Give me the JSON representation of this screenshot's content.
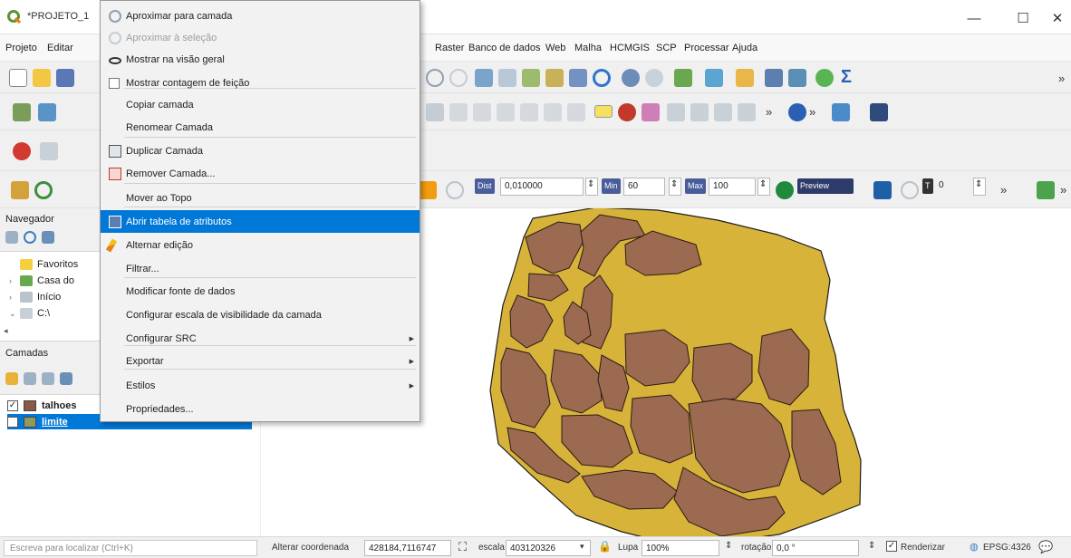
{
  "window": {
    "title": "*PROJETO_1",
    "minimize": "—",
    "maximize": "☐",
    "close": "✕"
  },
  "menubar": {
    "items": [
      "Projeto",
      "Editar",
      "Raster",
      "Banco de dados",
      "Web",
      "Malha",
      "HCMGIS",
      "SCP",
      "Processar",
      "Ajuda"
    ]
  },
  "toolbar": {
    "overflow": "»"
  },
  "snapping": {
    "dist_tag": "Dist",
    "dist_value": "0,010000",
    "min_tag": "Min",
    "min_value": "60",
    "max_tag": "Max",
    "max_value": "100",
    "preview_label": "Preview",
    "t_tag": "T",
    "t_value": "0"
  },
  "browser_panel": {
    "title": "Navegador",
    "items": [
      {
        "label": "Favoritos",
        "arrow": ""
      },
      {
        "label": "Casa do",
        "arrow": "›"
      },
      {
        "label": "Início",
        "arrow": "›"
      },
      {
        "label": "C:\\",
        "arrow": "⌄"
      }
    ],
    "scroll_left": "◂"
  },
  "layers_panel": {
    "title": "Camadas",
    "layers": [
      {
        "name": "talhoes",
        "checked": "✓",
        "color": "#8a5a44",
        "selected": false
      },
      {
        "name": "limite",
        "checked": "✓",
        "color": "#8f9a5e",
        "selected": true
      }
    ]
  },
  "context_menu": {
    "items": [
      {
        "label": "Aproximar para camada",
        "disabled": false,
        "selected": false,
        "submenu": false,
        "icon": "zoom-layer-icon"
      },
      {
        "label": "Aproximar à seleção",
        "disabled": true,
        "selected": false,
        "submenu": false,
        "icon": "zoom-selection-icon"
      },
      {
        "label": "Mostrar na visão geral",
        "disabled": false,
        "selected": false,
        "submenu": false,
        "icon": "overview-icon"
      },
      {
        "label": "Mostrar contagem de feição",
        "disabled": false,
        "selected": false,
        "submenu": false,
        "icon": "checkbox-icon"
      },
      {
        "label": "Copiar camada",
        "disabled": false,
        "selected": false,
        "submenu": false,
        "icon": ""
      },
      {
        "label": "Renomear Camada",
        "disabled": false,
        "selected": false,
        "submenu": false,
        "icon": ""
      },
      {
        "label": "Duplicar Camada",
        "disabled": false,
        "selected": false,
        "submenu": false,
        "icon": "duplicate-icon"
      },
      {
        "label": "Remover Camada...",
        "disabled": false,
        "selected": false,
        "submenu": false,
        "icon": "remove-icon"
      },
      {
        "label": "Mover ao Topo",
        "disabled": false,
        "selected": false,
        "submenu": false,
        "icon": ""
      },
      {
        "label": "Abrir tabela de atributos",
        "disabled": false,
        "selected": true,
        "submenu": false,
        "icon": "table-icon"
      },
      {
        "label": "Alternar edição",
        "disabled": false,
        "selected": false,
        "submenu": false,
        "icon": "pencil-icon"
      },
      {
        "label": "Filtrar...",
        "disabled": false,
        "selected": false,
        "submenu": false,
        "icon": ""
      },
      {
        "label": "Modificar fonte de dados",
        "disabled": false,
        "selected": false,
        "submenu": false,
        "icon": ""
      },
      {
        "label": "Configurar escala de visibilidade da camada",
        "disabled": false,
        "selected": false,
        "submenu": false,
        "icon": ""
      },
      {
        "label": "Configurar SRC",
        "disabled": false,
        "selected": false,
        "submenu": true,
        "icon": ""
      },
      {
        "label": "Exportar",
        "disabled": false,
        "selected": false,
        "submenu": true,
        "icon": ""
      },
      {
        "label": "Estilos",
        "disabled": false,
        "selected": false,
        "submenu": true,
        "icon": ""
      },
      {
        "label": "Propriedades...",
        "disabled": false,
        "selected": false,
        "submenu": false,
        "icon": ""
      }
    ],
    "submenu_arrow": "▶"
  },
  "map": {
    "background": "#ffffff",
    "limite_fill": "#d7b33a",
    "talhoes_fill": "#9b6a50",
    "outline": "#1c1c1c"
  },
  "statusbar": {
    "locator_placeholder": "Escreva para localizar (Ctrl+K)",
    "coord_label": "Alterar coordenada",
    "coord_value": "428184,7116747",
    "scale_label": "escala",
    "scale_value": "403120326",
    "magnifier_label": "Lupa",
    "magnifier_value": "100%",
    "rotation_label": "rotação",
    "rotation_value": "0,0 °",
    "render_check": "✓",
    "render_label": "Renderizar",
    "crs": "EPSG:4326"
  }
}
